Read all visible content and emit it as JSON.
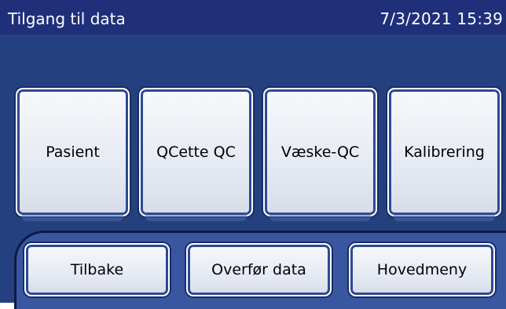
{
  "header": {
    "title": "Tilgang til data",
    "datetime": "7/3/2021 15:39"
  },
  "main_buttons": [
    {
      "label": "Pasient"
    },
    {
      "label": "QCette QC"
    },
    {
      "label": "Væske-QC"
    },
    {
      "label": "Kalibrering"
    }
  ],
  "bottom_buttons": [
    {
      "label": "Tilbake"
    },
    {
      "label": "Overfør data"
    },
    {
      "label": "Hovedmeny"
    }
  ],
  "colors": {
    "header_bg": "#1f2f7a",
    "content_bg": "#25407e",
    "bottom_bar_bg": "#3956a0",
    "button_face": "#e6eaf2"
  }
}
